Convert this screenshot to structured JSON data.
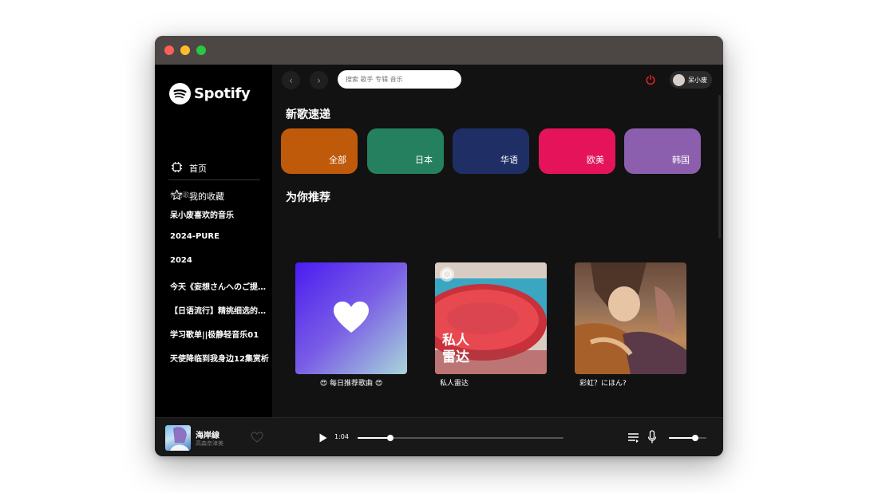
{
  "app": {
    "name": "Spotify",
    "accent": "#1db954"
  },
  "sidebar": {
    "nav": [
      {
        "label": "首页",
        "icon": "chip-icon"
      },
      {
        "label": "我的收藏",
        "icon": "star-icon"
      }
    ],
    "section_label": "你的歌单",
    "playlists": [
      "呆小废喜欢的音乐",
      "2024-PURE",
      "2024",
      "今天《妄想さんへのご提案》",
      "【日语流行】精挑细选的日语歌",
      "学习歌单||极静轻音乐01",
      "天使降临到我身边12集赏析"
    ]
  },
  "topbar": {
    "search_placeholder": "搜索 歌手 专辑 音乐",
    "user_name": "呆小废"
  },
  "main": {
    "new_songs_title": "新歌速递",
    "genres": [
      {
        "label": "全部",
        "color": "#bf5a0b"
      },
      {
        "label": "日本",
        "color": "#25805f"
      },
      {
        "label": "华语",
        "color": "#1f2f66"
      },
      {
        "label": "欧美",
        "color": "#e5145a"
      },
      {
        "label": "韩国",
        "color": "#8b5fae"
      }
    ],
    "recommend_title": "为你推荐",
    "cards": [
      {
        "title": "😍 每日推荐歌曲 😍"
      },
      {
        "title": "私人雷达",
        "cover_text": "私人\n雷达"
      },
      {
        "title": "彩虹？にほん?"
      }
    ]
  },
  "player": {
    "song_title": "海岸線",
    "artist": "高森奈津美",
    "current_time": "1:04",
    "progress": 0.16,
    "volume": 0.7
  }
}
